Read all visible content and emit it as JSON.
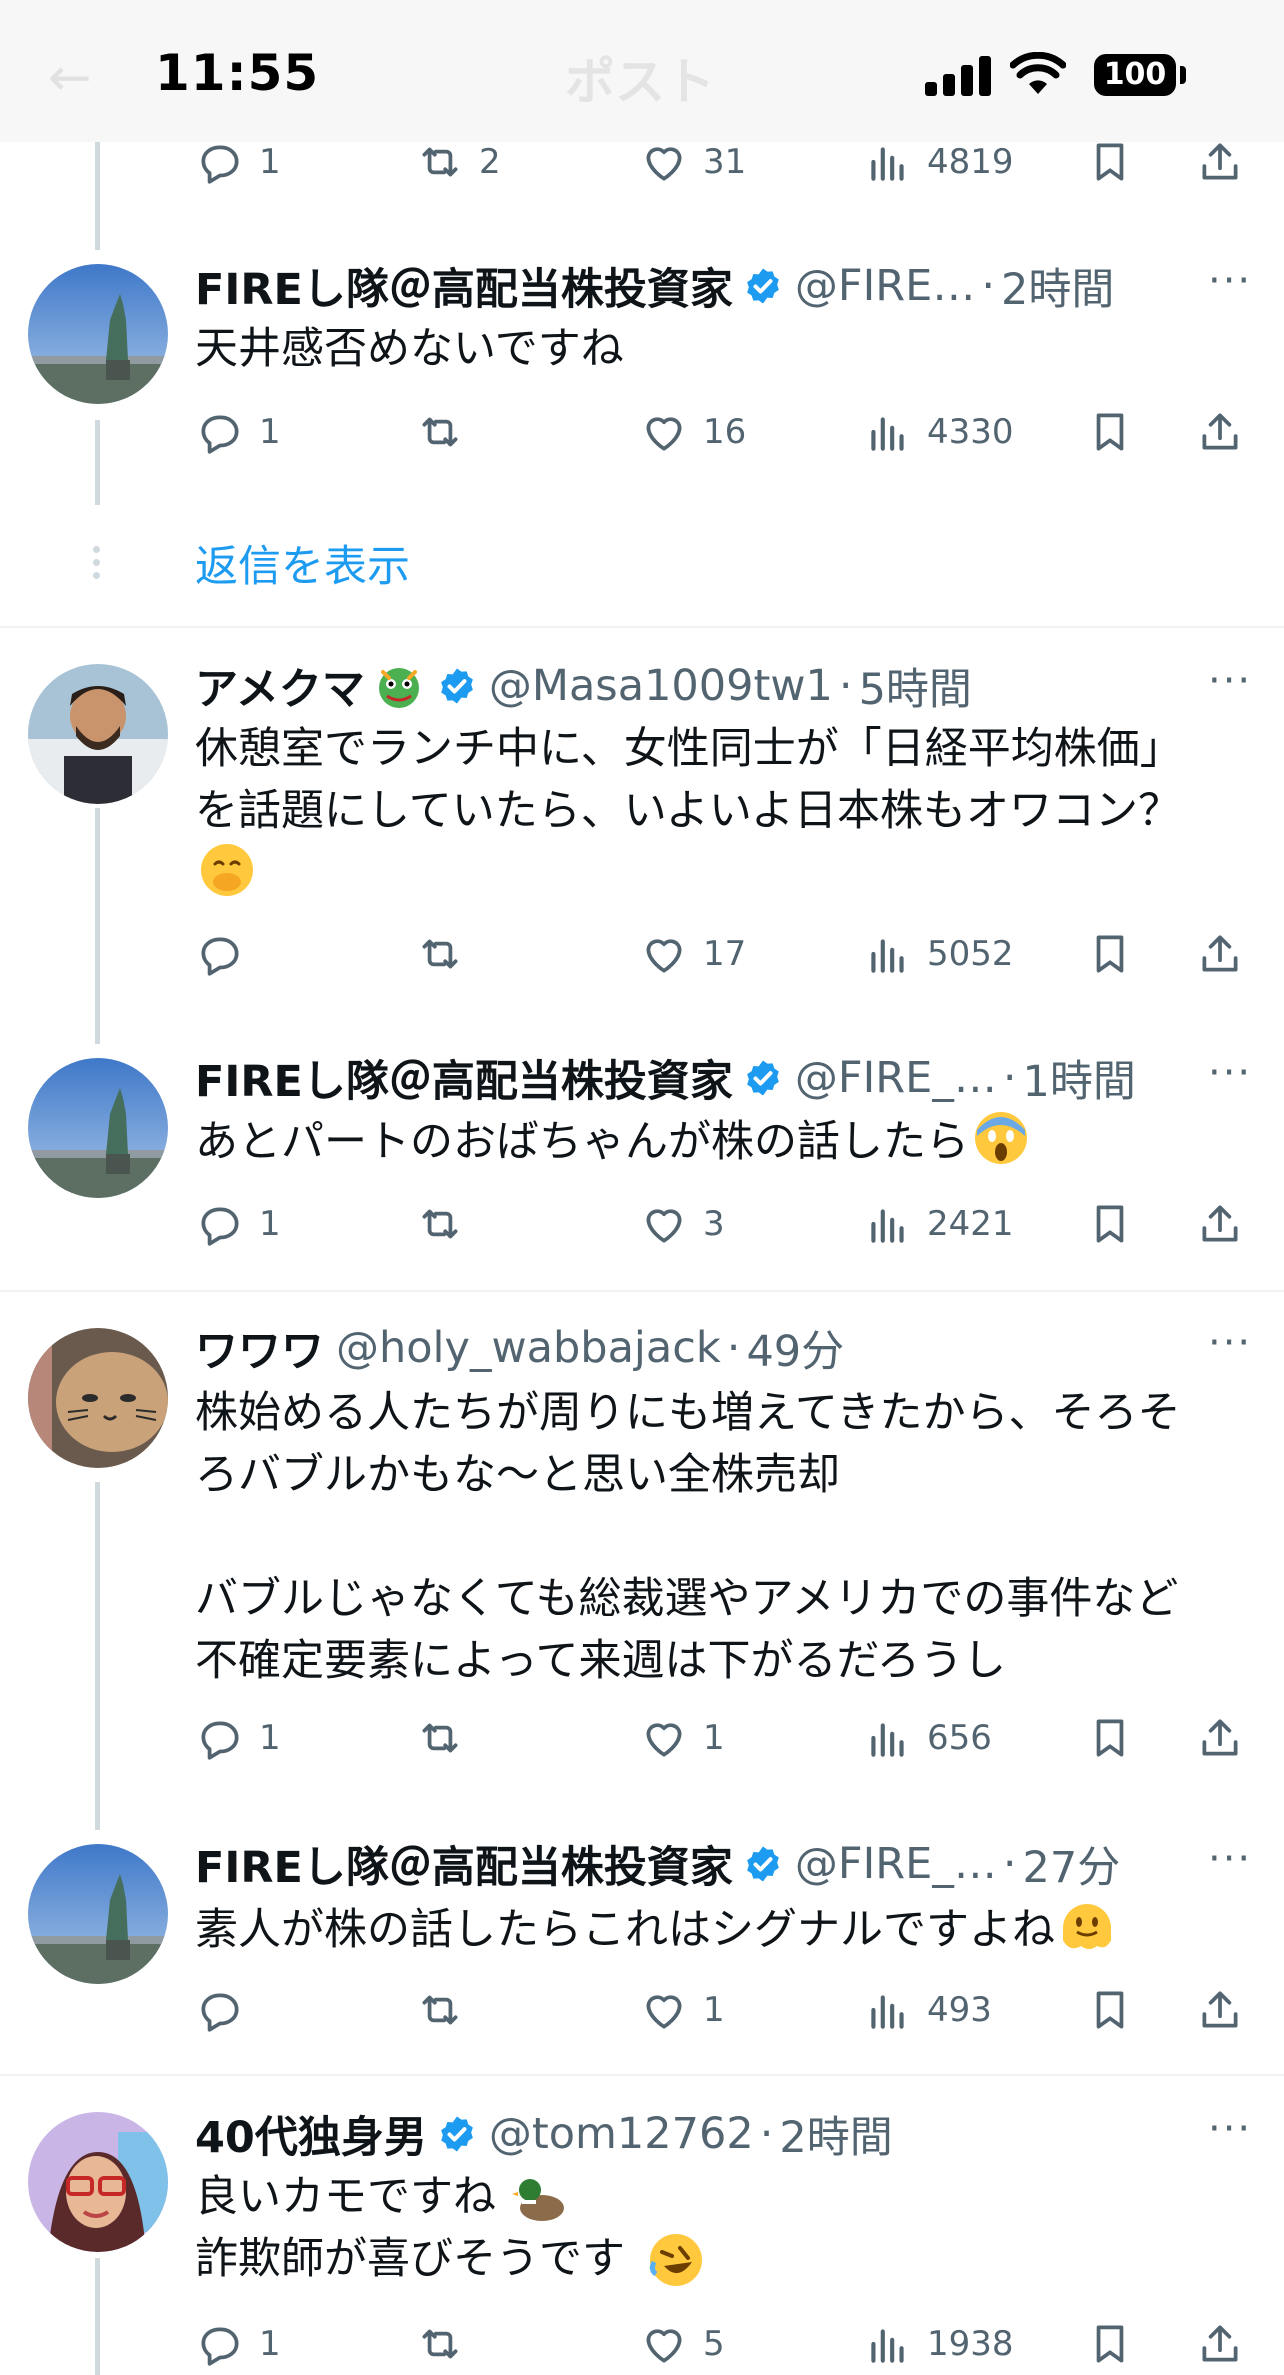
{
  "status_bar": {
    "time": "11:55",
    "battery": "100"
  },
  "header": {
    "back_glyph": "←",
    "title": "ポスト"
  },
  "show_replies": "返信を表示",
  "top_actions": {
    "replies": "1",
    "reposts": "2",
    "likes": "31",
    "views": "4819"
  },
  "posts": [
    {
      "name": "FIREし隊＠高配当株投資家",
      "handle": "@FIRE…",
      "time": "2時間",
      "text": "天井感否めないですね",
      "replies": "1",
      "reposts": "",
      "likes": "16",
      "views": "4330"
    },
    {
      "name": "アメクマ",
      "handle": "@Masa1009tw1",
      "time": "5時間",
      "text": "休憩室でランチ中に、女性同士が「日経平均株価」\nを話題にしていたら、いよいよ日本株もオワコン？",
      "emoji": "face-with-hand-over-mouth",
      "replies": "",
      "reposts": "",
      "likes": "17",
      "views": "5052"
    },
    {
      "name": "FIREし隊＠高配当株投資家",
      "handle": "@FIRE_…",
      "time": "1時間",
      "text": "あとパートのおばちゃんが株の話したら",
      "emoji": "screaming-face",
      "replies": "1",
      "reposts": "",
      "likes": "3",
      "views": "2421"
    },
    {
      "name": "ワワワ",
      "handle": "@holy_wabbajack",
      "time": "49分",
      "text": "株始める人たちが周りにも増えてきたから、そろそ\nろバブルかもな〜と思い全株売却\n\nバブルじゃなくても総裁選やアメリカでの事件など\n不確定要素によって来週は下がるだろうし",
      "replies": "1",
      "reposts": "",
      "likes": "1",
      "views": "656"
    },
    {
      "name": "FIREし隊＠高配当株投資家",
      "handle": "@FIRE_…",
      "time": "27分",
      "text": "素人が株の話したらこれはシグナルですよね",
      "emoji": "melting-face",
      "replies": "",
      "reposts": "",
      "likes": "1",
      "views": "493"
    },
    {
      "name": "40代独身男",
      "handle": "@tom12762",
      "time": "2時間",
      "text": "良いカモですね\n詐欺師が喜びそうです",
      "emoji": "duck",
      "replies": "1",
      "reposts": "",
      "likes": "5",
      "views": "1938"
    }
  ],
  "colors": {
    "accent": "#1d9bf0",
    "muted": "#536471",
    "thread_line": "#cfd9de",
    "divider": "#eff3f4"
  }
}
